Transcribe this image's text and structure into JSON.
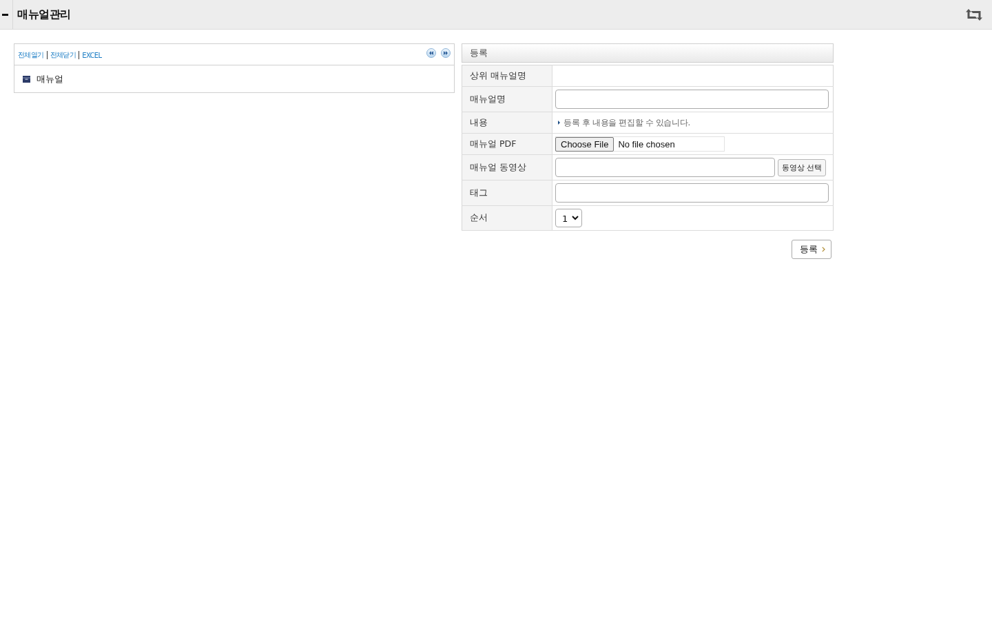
{
  "header": {
    "title": "매뉴얼관리"
  },
  "tree_panel": {
    "links": [
      "전체열기",
      "전체닫기",
      "EXCEL"
    ],
    "tree": [
      {
        "label": "매뉴얼"
      }
    ]
  },
  "form": {
    "title": "등록",
    "rows": [
      {
        "label": "상위 매뉴얼명",
        "kind": "empty"
      },
      {
        "label": "매뉴얼명",
        "kind": "input"
      },
      {
        "label": "내용",
        "kind": "note",
        "note": "등록 후 내용을 편집할 수 있습니다."
      },
      {
        "label": "매뉴얼 PDF",
        "kind": "file",
        "button": "Choose File",
        "status": "No file chosen"
      },
      {
        "label": "매뉴얼 동영상",
        "kind": "input_button",
        "button": "동영상 선택"
      },
      {
        "label": "태그",
        "kind": "input"
      },
      {
        "label": "순서",
        "kind": "select",
        "value": "1"
      }
    ],
    "submit": "등록"
  }
}
